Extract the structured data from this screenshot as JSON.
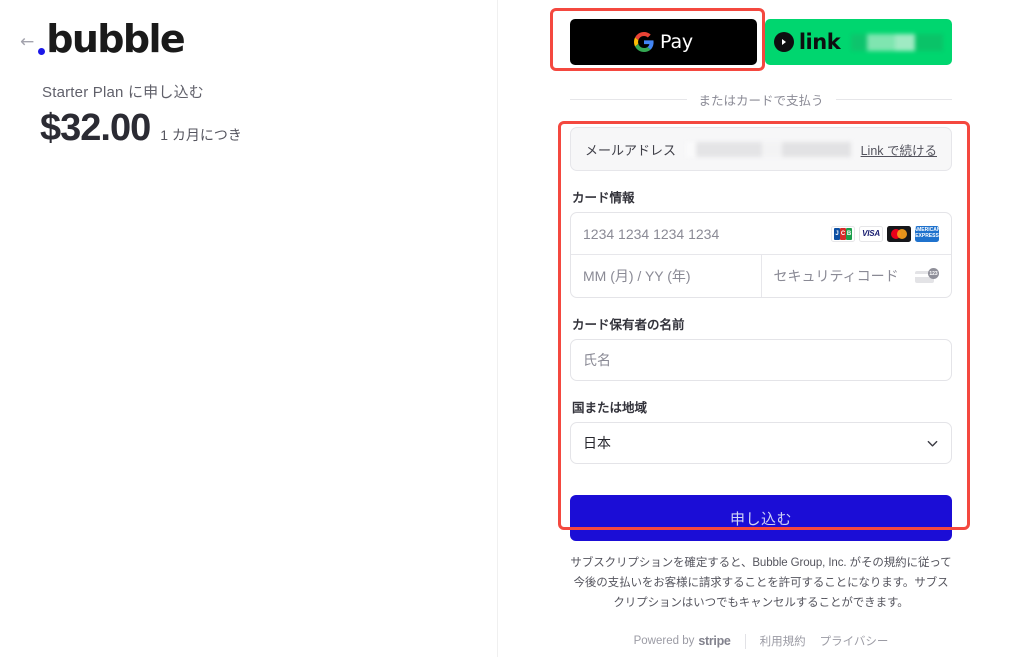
{
  "left": {
    "back_icon": "back-arrow-icon",
    "brand": "bubble",
    "plan_title": "Starter Plan に申し込む",
    "price": "$32.00",
    "price_period": "1 カ月につき"
  },
  "wallets": {
    "google_pay_label": "Pay",
    "google_pay_icon": "google-g-icon",
    "link_label": "link",
    "link_icon": "link-arrow-icon",
    "link_blurred_value": ""
  },
  "divider": {
    "text": "またはカードで支払う"
  },
  "form": {
    "email": {
      "label": "メールアドレス",
      "value": "",
      "link_continue": "Link で続ける"
    },
    "card": {
      "label": "カード情報",
      "number_placeholder": "1234 1234 1234 1234",
      "expiry_placeholder": "MM (月) / YY (年)",
      "cvc_placeholder": "セキュリティコード",
      "brands": [
        {
          "name": "jcb",
          "text": "JCB"
        },
        {
          "name": "visa",
          "text": "VISA"
        },
        {
          "name": "mastercard",
          "text": ""
        },
        {
          "name": "amex",
          "text": "AMERICAN EXPRESS"
        }
      ],
      "cvc_icon_digits": "123"
    },
    "cardholder": {
      "label": "カード保有者の名前",
      "placeholder": "氏名",
      "value": ""
    },
    "country": {
      "label": "国または地域",
      "selected": "日本",
      "chevron_icon": "chevron-down-icon"
    },
    "submit_label": "申し込む"
  },
  "disclaimer": "サブスクリプションを確定すると、Bubble Group, Inc. がその規約に従って今後の支払いをお客様に請求することを許可することになります。サブスクリプションはいつでもキャンセルすることができます。",
  "footer": {
    "powered_by": "Powered by",
    "stripe": "stripe",
    "terms": "利用規約",
    "privacy": "プライバシー"
  },
  "colors": {
    "accent_blue": "#1b0dd6",
    "link_green": "#00d66f",
    "gpay_black": "#000000",
    "annotation_red": "#f4483f",
    "logo_dot_blue": "#1b17e8"
  }
}
